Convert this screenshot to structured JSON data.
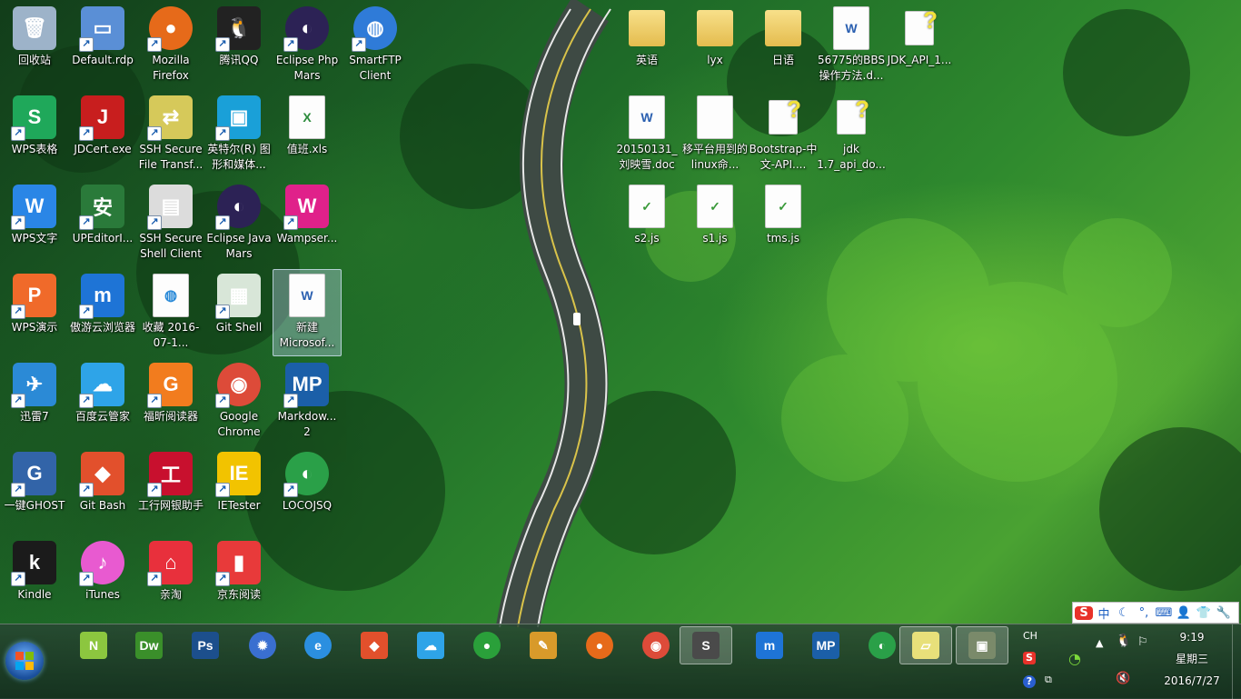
{
  "desktop": {
    "icons": [
      {
        "label": "回收站",
        "icon": "recycle-bin-icon",
        "color": "#9db3c9"
      },
      {
        "label": "Default.rdp",
        "icon": "remote-desktop-icon",
        "color": "#5a8fd6"
      },
      {
        "label": "Mozilla Firefox",
        "icon": "firefox-icon",
        "color": "#e66a1a"
      },
      {
        "label": "腾讯QQ",
        "icon": "qq-penguin-icon",
        "color": "#222222"
      },
      {
        "label": "Eclipse Php Mars",
        "icon": "eclipse-icon",
        "color": "#2c2255"
      },
      {
        "label": "SmartFTP Client",
        "icon": "smartftp-globe-icon",
        "color": "#2f7bd8"
      },
      {
        "label": "WPS表格",
        "icon": "wps-spreadsheet-icon",
        "color": "#1fa85a"
      },
      {
        "label": "JDCert.exe",
        "icon": "jdcert-shield-icon",
        "color": "#c81e1e"
      },
      {
        "label": "SSH Secure File Transf...",
        "icon": "ssh-file-transfer-icon",
        "color": "#d6c95a"
      },
      {
        "label": "英特尔(R) 图形和媒体...",
        "icon": "intel-graphics-icon",
        "color": "#1aa0d8"
      },
      {
        "label": "值班.xls",
        "icon": "xls-file-icon",
        "color": "#eeeeee"
      },
      {
        "label": "WPS文字",
        "icon": "wps-writer-icon",
        "color": "#2a86e6"
      },
      {
        "label": "UPEditorI...",
        "icon": "security-shield-icon",
        "color": "#2a7a3a"
      },
      {
        "label": "SSH Secure Shell Client",
        "icon": "ssh-shell-icon",
        "color": "#dcdcdc"
      },
      {
        "label": "Eclipse Java Mars",
        "icon": "eclipse-icon",
        "color": "#2c2255"
      },
      {
        "label": "Wampser...",
        "icon": "wampserver-icon",
        "color": "#e0218a"
      },
      {
        "label": "WPS演示",
        "icon": "wps-presentation-icon",
        "color": "#f06a2a"
      },
      {
        "label": "傲游云浏览器",
        "icon": "maxthon-icon",
        "color": "#1e74d6"
      },
      {
        "label": "收藏 2016-07-1...",
        "icon": "web-shortcut-icon",
        "color": "#f4f8fc"
      },
      {
        "label": "Git Shell",
        "icon": "git-shell-icon",
        "color": "#d8e6d8"
      },
      {
        "label": "新建 Microsof...",
        "icon": "word-document-icon",
        "color": "#f4f4f4"
      },
      {
        "label": "迅雷7",
        "icon": "thunder-bird-icon",
        "color": "#2b8ad6"
      },
      {
        "label": "百度云管家",
        "icon": "baidu-cloud-icon",
        "color": "#2ea4e8"
      },
      {
        "label": "福昕阅读器",
        "icon": "foxit-reader-icon",
        "color": "#f27c1e"
      },
      {
        "label": "Google Chrome",
        "icon": "chrome-icon",
        "color": "#dd4b39"
      },
      {
        "label": "Markdow... 2",
        "icon": "markdownpad-icon",
        "color": "#1b5fa8"
      },
      {
        "label": "一键GHOST",
        "icon": "ghost-icon",
        "color": "#3264a8"
      },
      {
        "label": "Git Bash",
        "icon": "git-bash-icon",
        "color": "#e2502c"
      },
      {
        "label": "工行网银助手",
        "icon": "icbc-icon",
        "color": "#c8102e"
      },
      {
        "label": "IETester",
        "icon": "ietester-icon",
        "color": "#f2c300"
      },
      {
        "label": "LOCOJSQ",
        "icon": "locojsq-icon",
        "color": "#2aa048"
      },
      {
        "label": "Kindle",
        "icon": "kindle-icon",
        "color": "#1b1b1b"
      },
      {
        "label": "iTunes",
        "icon": "itunes-icon",
        "color": "#e85ad0"
      },
      {
        "label": "亲淘",
        "icon": "qintao-bag-icon",
        "color": "#e8303c"
      },
      {
        "label": "京东阅读",
        "icon": "jd-reader-icon",
        "color": "#e83a3a"
      },
      {
        "label": "英语",
        "icon": "folder-icon",
        "color": "#e8c85a"
      },
      {
        "label": "lyx",
        "icon": "folder-icon",
        "color": "#e8c85a"
      },
      {
        "label": "日语",
        "icon": "folder-icon",
        "color": "#e8c85a"
      },
      {
        "label": "56775的BBS操作方法.d...",
        "icon": "word-document-icon",
        "color": "#f4f4f4"
      },
      {
        "label": "JDK_API_1...",
        "icon": "help-file-icon",
        "color": "#f2e23a"
      },
      {
        "label": "20150131_刘映雪.doc",
        "icon": "word-document-icon",
        "color": "#f4f4f4"
      },
      {
        "label": "移平台用到的linux命...",
        "icon": "text-file-icon",
        "color": "#f4f4f4"
      },
      {
        "label": "Bootstrap-中文-API....",
        "icon": "help-file-icon",
        "color": "#f2e23a"
      },
      {
        "label": "jdk 1.7_api_do...",
        "icon": "help-file-icon",
        "color": "#f2e23a"
      },
      {
        "label": "s2.js",
        "icon": "js-file-icon",
        "color": "#f4f4f4"
      },
      {
        "label": "s1.js",
        "icon": "js-file-icon",
        "color": "#f4f4f4"
      },
      {
        "label": "tms.js",
        "icon": "js-file-icon",
        "color": "#f4f4f4"
      }
    ]
  },
  "ime_bar": {
    "items": [
      "S",
      "中",
      "☾",
      "°,",
      "⌨",
      "👤",
      "👕",
      "🔧"
    ],
    "accent": "#e8322a"
  },
  "taskbar": {
    "start_label": "Start",
    "apps": [
      {
        "name": "notepadpp-icon",
        "glyph": "N",
        "color": "#8cc63f"
      },
      {
        "name": "dreamweaver-icon",
        "glyph": "Dw",
        "color": "#3a8f2a"
      },
      {
        "name": "photoshop-icon",
        "glyph": "Ps",
        "color": "#1c4f8c"
      },
      {
        "name": "settings-gear-icon",
        "glyph": "✹",
        "color": "#3a6fd0"
      },
      {
        "name": "internet-explorer-icon",
        "glyph": "e",
        "color": "#2b8fe0"
      },
      {
        "name": "git-icon",
        "glyph": "◆",
        "color": "#e2502c"
      },
      {
        "name": "baidu-cloud-icon",
        "glyph": "☁",
        "color": "#2ea4e8"
      },
      {
        "name": "wechat-frog-icon",
        "glyph": "●",
        "color": "#2aa03a"
      },
      {
        "name": "feeds-tool-icon",
        "glyph": "✎",
        "color": "#d89a2a"
      },
      {
        "name": "firefox-icon",
        "glyph": "●",
        "color": "#e66a1a"
      },
      {
        "name": "chrome-icon",
        "glyph": "◉",
        "color": "#dd4b39"
      },
      {
        "name": "sublime-text-icon",
        "glyph": "S",
        "color": "#4a4a4a"
      },
      {
        "name": "maxthon-icon",
        "glyph": "m",
        "color": "#1e74d6"
      },
      {
        "name": "markdownpad-icon",
        "glyph": "MP",
        "color": "#1b5fa8"
      },
      {
        "name": "locojsq-icon",
        "glyph": "◐",
        "color": "#2aa048"
      },
      {
        "name": "sticky-notes-icon",
        "glyph": "▱",
        "color": "#e8e07a"
      },
      {
        "name": "photo-viewer-icon",
        "glyph": "▣",
        "color": "#7a8a6a"
      }
    ]
  },
  "tray": {
    "lang": "CH",
    "time": "9:19",
    "weekday": "星期三",
    "date": "2016/7/27"
  }
}
